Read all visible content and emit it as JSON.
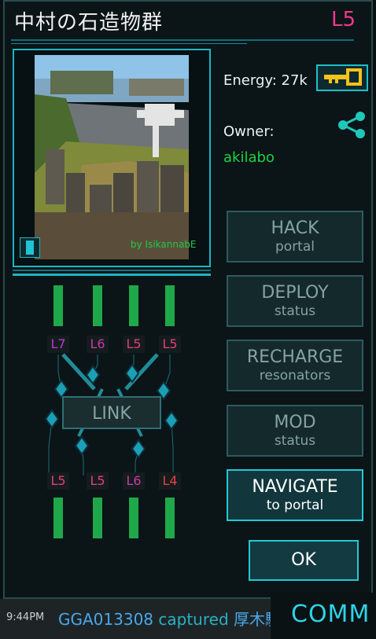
{
  "portal": {
    "title": "中村の石造物群",
    "level": "L5"
  },
  "photo": {
    "credit": "by IsikannabE"
  },
  "energy": {
    "label": "Energy:",
    "value": "27k"
  },
  "owner": {
    "label": "Owner:",
    "name": "akilabo"
  },
  "buttons": {
    "hack": {
      "line1": "HACK",
      "line2": "portal"
    },
    "deploy": {
      "line1": "DEPLOY",
      "line2": "status"
    },
    "recharge": {
      "line1": "RECHARGE",
      "line2": "resonators"
    },
    "mod": {
      "line1": "MOD",
      "line2": "status"
    },
    "navigate": {
      "line1": "NAVIGATE",
      "line2": "to portal"
    },
    "ok": "OK",
    "link": "LINK"
  },
  "resonators": {
    "top": [
      "L7",
      "L6",
      "L5",
      "L5"
    ],
    "bottom": [
      "L5",
      "L5",
      "L6",
      "L4"
    ],
    "colors": {
      "L7": "#b63ad0",
      "L6": "#c83aa8",
      "L5": "#e0407a",
      "L4": "#e84040"
    },
    "fill_levels": [
      1,
      1,
      1,
      1,
      1,
      1,
      1,
      1
    ]
  },
  "status_bar": {
    "time": "9:44PM",
    "player": "GGA013308",
    "action": "captured",
    "target": "厚木駅"
  },
  "comm": "COMM",
  "icons": [
    "key-icon",
    "share-icon",
    "info-icon"
  ],
  "colors": {
    "accent": "#1bb6c4",
    "owner": "#22d142",
    "level": "#f0388c"
  }
}
